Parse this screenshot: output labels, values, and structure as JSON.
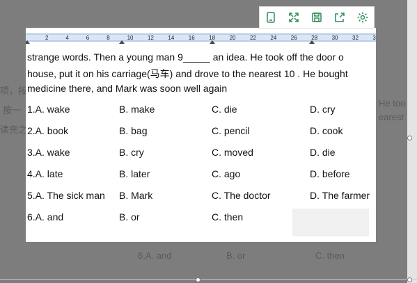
{
  "background": {
    "lines": [
      "项，按",
      "按一",
      "读完之"
    ],
    "right_lines": [
      "He too",
      "earest 1"
    ],
    "bottom_options": [
      "6.A. and",
      "B. or",
      "C. then"
    ]
  },
  "toolbar": {
    "icons": [
      "phone-icon",
      "expand-icon",
      "save-icon",
      "share-icon",
      "settings-icon"
    ]
  },
  "ruler": {
    "ticks": [
      "2",
      "4",
      "6",
      "8",
      "10",
      "12",
      "14",
      "16",
      "18",
      "20",
      "22",
      "24",
      "26",
      "28",
      "30",
      "32",
      "3"
    ]
  },
  "passage": {
    "line1": "strange words.  Then a young man    9_____   an idea.  He took off the door o",
    "line2": "house, put it on his carriage(马车) and drove to the nearest 10   .  He bought",
    "line3": "medicine there, and Mark was soon well again"
  },
  "questions": [
    {
      "a": "1.A. wake",
      "b": "B. make",
      "c": "C. die",
      "d": "D. cry"
    },
    {
      "a": "2.A. book",
      "b": "B. bag",
      "c": "C. pencil",
      "d": "D. cook"
    },
    {
      "a": "3.A. wake",
      "b": "B. cry",
      "c": "C. moved",
      "d": "D. die"
    },
    {
      "a": "4.A. late",
      "b": "B. later",
      "c": "C. ago",
      "d": "D. before"
    },
    {
      "a": "5.A. The sick man",
      "b": "B. Mark",
      "c": "C. The doctor",
      "d": "D. The farmer"
    },
    {
      "a": "6.A. and",
      "b": "B. or",
      "c": "C. then",
      "d": ""
    }
  ],
  "colors": {
    "ruler_band": "#b9cde9",
    "toolbar_icon": "#2e8b57"
  }
}
